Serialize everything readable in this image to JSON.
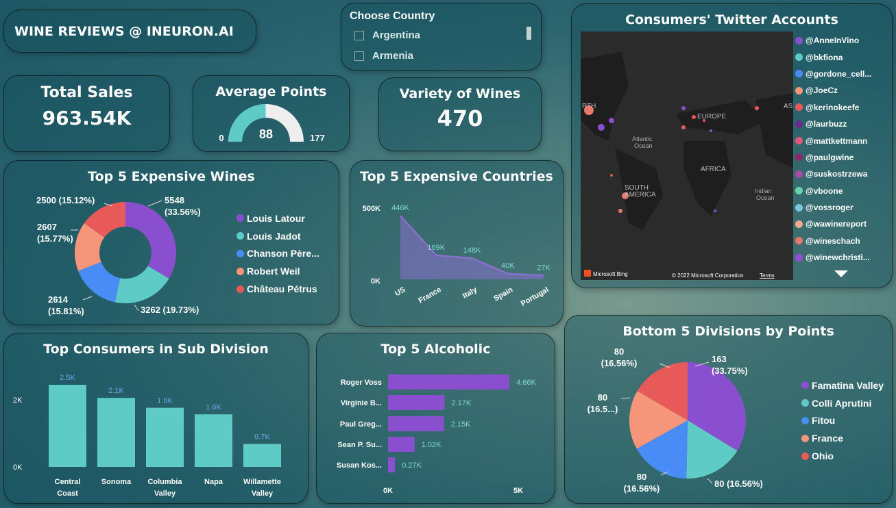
{
  "header": {
    "title": "WINE REVIEWS @ INEURON.AI"
  },
  "slicer": {
    "title": "Choose Country",
    "options": [
      "Argentina",
      "Armenia"
    ]
  },
  "kpis": {
    "total_sales": {
      "title": "Total Sales",
      "value": "963.54K"
    },
    "average_points": {
      "title": "Average Points",
      "value": "88",
      "min": "0",
      "max": "177",
      "fraction": 0.497
    },
    "variety": {
      "title": "Variety of Wines",
      "value": "470"
    }
  },
  "twitter": {
    "title": "Consumers' Twitter Accounts",
    "accounts": [
      {
        "handle": "@AnneInVino",
        "color": "#8a4fcf"
      },
      {
        "handle": "@bkfiona",
        "color": "#5ecbc6"
      },
      {
        "handle": "@gordone_cell...",
        "color": "#4a8cf5"
      },
      {
        "handle": "@JoeCz",
        "color": "#f5967a"
      },
      {
        "handle": "@kerinokeefe",
        "color": "#e85a5a"
      },
      {
        "handle": "@laurbuzz",
        "color": "#6a2a8a"
      },
      {
        "handle": "@mattkettmann",
        "color": "#e2587a"
      },
      {
        "handle": "@paulgwine",
        "color": "#8a2a6a"
      },
      {
        "handle": "@suskostrzewa",
        "color": "#a84aa8"
      },
      {
        "handle": "@vboone",
        "color": "#6ad2a8"
      },
      {
        "handle": "@vossroger",
        "color": "#7ac8d8"
      },
      {
        "handle": "@wawinereport",
        "color": "#f5a88a"
      },
      {
        "handle": "@wineschach",
        "color": "#e8786a"
      },
      {
        "handle": "@winewchristi...",
        "color": "#9a4ad8"
      }
    ],
    "map_labels": {
      "north_america": "RTH\nRICA",
      "europe": "EUROPE",
      "asia": "ASI",
      "atlantic": "Atlantic\nOcean",
      "africa": "AFRICA",
      "south_america": "SOUTH\nAMERICA",
      "indian": "Indian\nOcean"
    },
    "bing": "Microsoft Bing",
    "copyright": "© 2022 Microsoft Corporation",
    "terms": "Terms"
  },
  "expensive_wines": {
    "title": "Top 5 Expensive Wines",
    "chart_data": {
      "type": "pie",
      "title": "Top 5 Expensive Wines",
      "donut": true,
      "categories": [
        "Louis Latour",
        "Louis Jadot",
        "Chanson Pèr…",
        "Robert Weil",
        "Château Pétrus"
      ],
      "values": [
        5548,
        3262,
        2614,
        2607,
        2500
      ],
      "percent_labels": [
        "5548 (33.56%)",
        "3262 (19.73%)",
        "2614 (15.81%)",
        "2607 (15.77%)",
        "2500 (15.12%)"
      ],
      "legend": [
        "Louis Latour",
        "Louis Jadot",
        "Chanson Père...",
        "Robert Weil",
        "Château Pétrus"
      ],
      "colors": [
        "#8a4fcf",
        "#5ecbc6",
        "#4a8cf5",
        "#f5967a",
        "#e85a5a"
      ]
    }
  },
  "expensive_countries": {
    "title": "Top 5 Expensive Countries",
    "chart_data": {
      "type": "area",
      "title": "Top 5 Expensive Countries",
      "categories": [
        "US",
        "France",
        "Italy",
        "Spain",
        "Portugal"
      ],
      "values": [
        446000,
        169000,
        148000,
        40000,
        27000
      ],
      "data_labels": [
        "446K",
        "169K",
        "148K",
        "40K",
        "27K"
      ],
      "y_ticks": [
        "500K",
        "0K"
      ],
      "ylim": [
        0,
        500000
      ],
      "color": "#8a6fd0"
    }
  },
  "sub_division": {
    "title": "Top Consumers in Sub Division",
    "chart_data": {
      "type": "bar",
      "title": "Top Consumers in Sub Division",
      "categories": [
        "Central Coast",
        "Sonoma",
        "Columbia Valley",
        "Napa",
        "Willamette Valley"
      ],
      "values": [
        2500,
        2100,
        1800,
        1600,
        700
      ],
      "data_labels": [
        "2.5K",
        "2.1K",
        "1.8K",
        "1.6K",
        "0.7K"
      ],
      "y_ticks": [
        "2K",
        "0K"
      ],
      "ylim": [
        0,
        2500
      ],
      "color": "#5ecbc6"
    }
  },
  "alcoholic": {
    "title": "Top 5 Alcoholic",
    "chart_data": {
      "type": "bar",
      "orientation": "horizontal",
      "title": "Top 5 Alcoholic",
      "categories": [
        "Roger Voss",
        "Virginie B...",
        "Paul Greg...",
        "Sean P. Su...",
        "Susan Kos..."
      ],
      "values": [
        4660,
        2170,
        2150,
        1020,
        270
      ],
      "data_labels": [
        "4.66K",
        "2.17K",
        "2.15K",
        "1.02K",
        "0.27K"
      ],
      "x_ticks": [
        "0K",
        "5K"
      ],
      "xlim": [
        0,
        5000
      ],
      "color": "#8a4fcf"
    }
  },
  "bottom_divisions": {
    "title": "Bottom 5 Divisions by Points",
    "chart_data": {
      "type": "pie",
      "title": "Bottom 5 Divisions by Points",
      "categories": [
        "Famatina Valley",
        "Colli Aprutini",
        "Fitou",
        "France",
        "Ohio"
      ],
      "values": [
        163,
        80,
        80,
        80,
        80
      ],
      "labels": [
        [
          "163",
          "(33.75%)"
        ],
        [
          "80 (16.56%)"
        ],
        [
          "80",
          "(16.56%)"
        ],
        [
          "80",
          "(16.5...)"
        ],
        [
          "80",
          "(16.56%)"
        ]
      ],
      "colors": [
        "#8a4fcf",
        "#5ecbc6",
        "#4a8cf5",
        "#f5967a",
        "#e85a5a"
      ]
    }
  }
}
